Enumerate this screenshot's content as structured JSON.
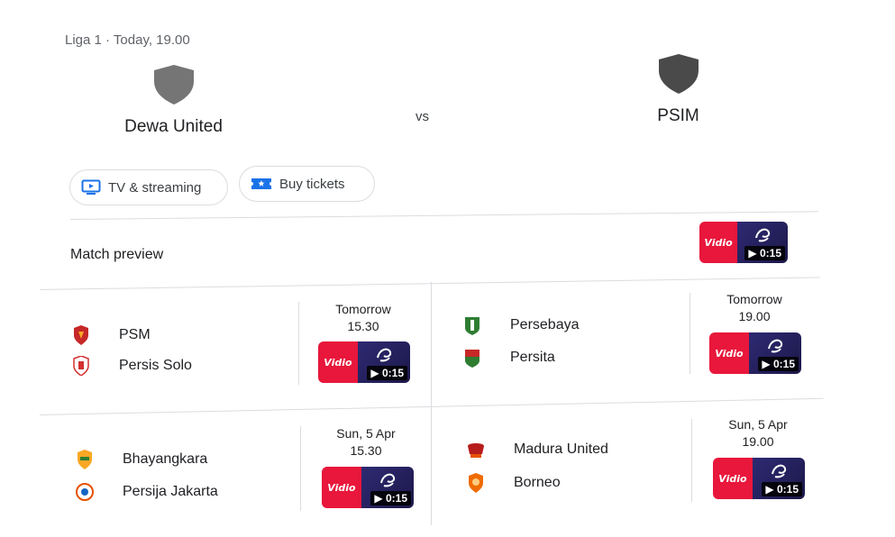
{
  "header": {
    "league_info": "Liga 1 · Today, 19.00",
    "home_team": "Dewa United",
    "vs_label": "vs",
    "away_team": "PSIM"
  },
  "chips": {
    "tv_label": "TV & streaming",
    "tickets_label": "Buy tickets"
  },
  "preview": {
    "label": "Match preview",
    "thumb_brand": "Vidio",
    "thumb_duration": "▶ 0:15"
  },
  "matches": [
    {
      "home": "PSM",
      "away": "Persis Solo",
      "day": "Tomorrow",
      "time": "15.30",
      "brand": "Vidio",
      "duration": "▶ 0:15"
    },
    {
      "home": "Persebaya",
      "away": "Persita",
      "day": "Tomorrow",
      "time": "19.00",
      "brand": "Vidio",
      "duration": "▶ 0:15"
    },
    {
      "home": "Bhayangkara",
      "away": "Persija Jakarta",
      "day": "Sun, 5 Apr",
      "time": "15.30",
      "brand": "Vidio",
      "duration": "▶ 0:15"
    },
    {
      "home": "Madura United",
      "away": "Borneo",
      "day": "Sun, 5 Apr",
      "time": "19.00",
      "brand": "Vidio",
      "duration": "▶ 0:15"
    }
  ],
  "colors": {
    "vidio_red": "#e8173b",
    "thumb_dark": "#2e2a73",
    "shield_grey": "#757575",
    "divider": "#dadce0"
  },
  "icons": {
    "tv": "tv-icon",
    "ticket": "ticket-icon",
    "shield": "shield-icon",
    "play": "play-icon"
  }
}
